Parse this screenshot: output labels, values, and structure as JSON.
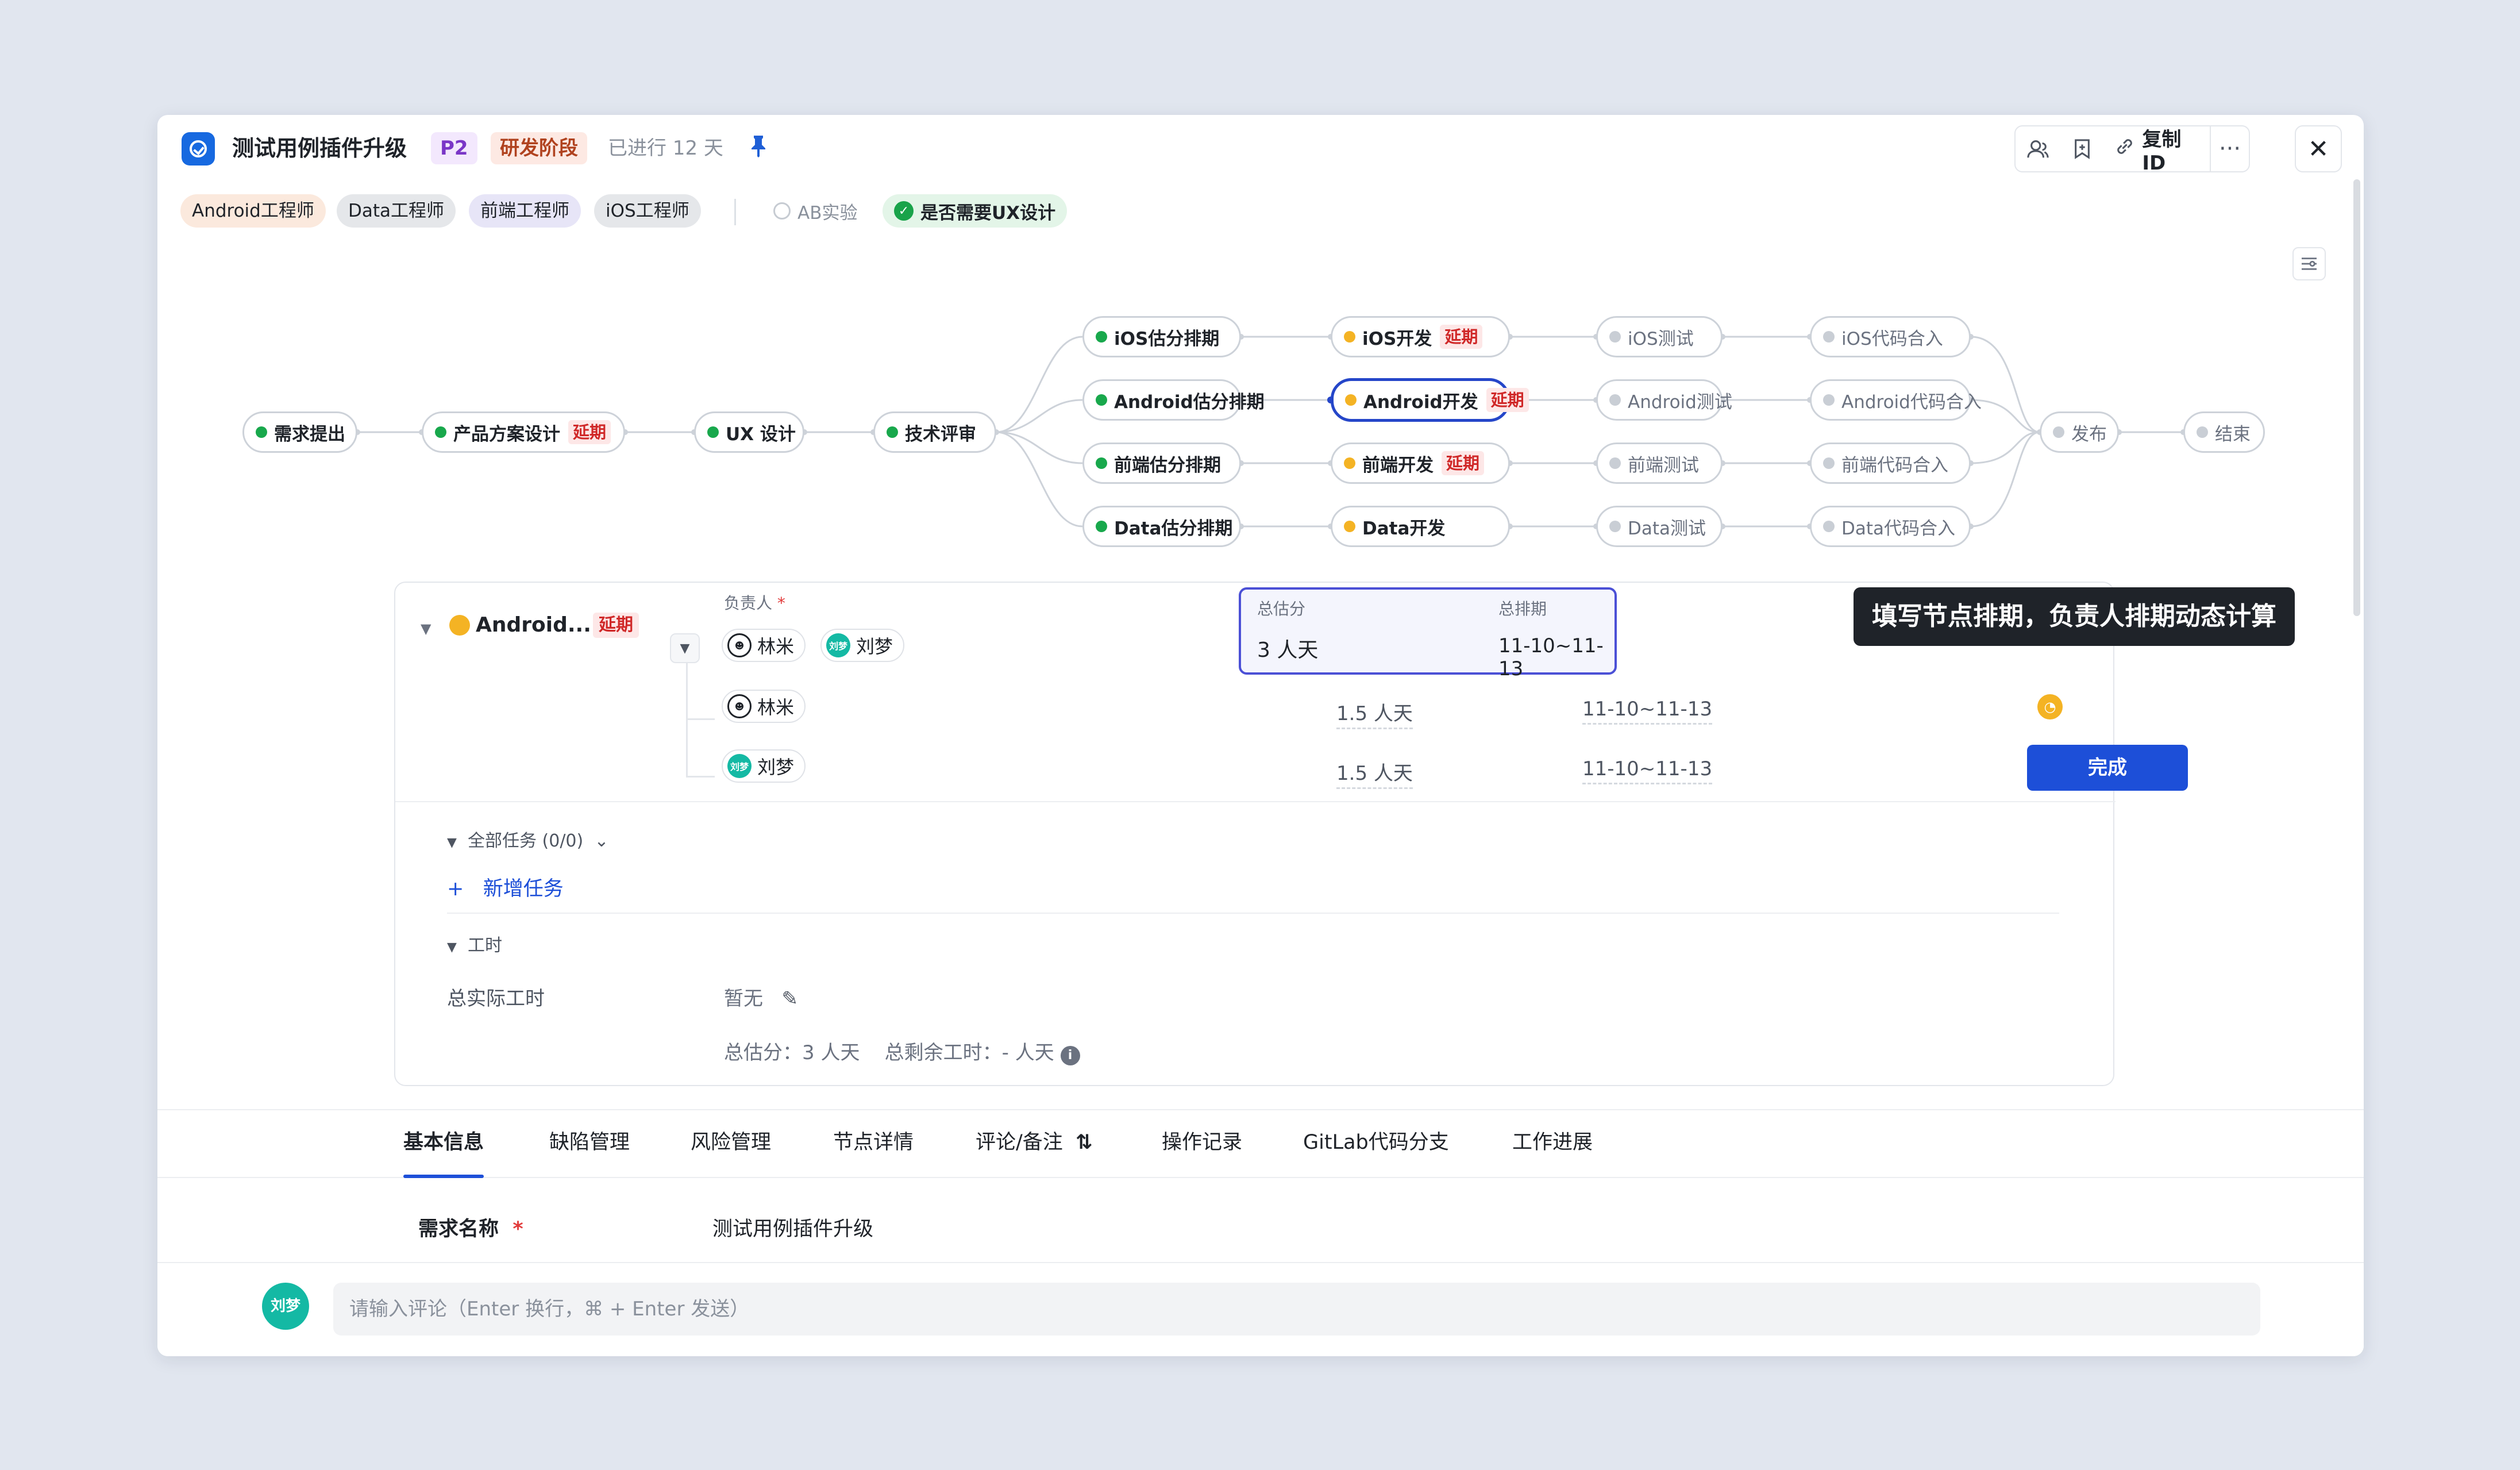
{
  "header": {
    "title": "测试用例插件升级",
    "priority": "P2",
    "stage": "研发阶段",
    "elapsed": "已进行 12 天",
    "copy_id": "复制ID",
    "more": "···",
    "close": "✕"
  },
  "roles": [
    "Android工程师",
    "Data工程师",
    "前端工程师",
    "iOS工程师"
  ],
  "toggles": {
    "ab": "AB实验",
    "ux": "是否需要UX设计"
  },
  "flow": {
    "start": "需求提出",
    "design": "产品方案设计",
    "ux": "UX 设计",
    "review": "技术评审",
    "delay": "延期",
    "estimate": [
      "iOS估分排期",
      "Android估分排期",
      "前端估分排期",
      "Data估分排期"
    ],
    "develop": [
      "iOS开发",
      "Android开发",
      "前端开发",
      "Data开发"
    ],
    "test": [
      "iOS测试",
      "Android测试",
      "前端测试",
      "Data测试"
    ],
    "merge": [
      "iOS代码合入",
      "Android代码合入",
      "前端代码合入",
      "Data代码合入"
    ],
    "release": "发布",
    "end": "结束"
  },
  "detail": {
    "node_name": "Android...",
    "delay": "延期",
    "owner_label": "负责人",
    "required": "*",
    "owners": [
      "林米",
      "刘梦"
    ],
    "avatar_liu": "刘梦",
    "total_estimate_label": "总估分",
    "total_schedule_label": "总排期",
    "total_estimate": "3 人天",
    "total_schedule": "11-10~11-13",
    "rows": [
      {
        "person": "林米",
        "estimate": "1.5 人天",
        "schedule": "11-10~11-13"
      },
      {
        "person": "刘梦",
        "estimate": "1.5 人天",
        "schedule": "11-10~11-13"
      }
    ],
    "done": "完成",
    "tooltip": "填写节点排期，负责人排期动态计算",
    "all_tasks": "全部任务 (0/0)",
    "add_task": "新增任务",
    "worktime": "工时",
    "actual_label": "总实际工时",
    "actual_value": "暂无",
    "summary": "总估分：3 人天    总剩余工时：- 人天"
  },
  "tabs": [
    "基本信息",
    "缺陷管理",
    "风险管理",
    "节点详情",
    "评论/备注",
    "操作记录",
    "GitLab代码分支",
    "工作进展"
  ],
  "basic": {
    "name_label": "需求名称",
    "required": "*",
    "name_value": "测试用例插件升级"
  },
  "comment": {
    "avatar": "刘梦",
    "placeholder": "请输入评论（Enter 换行，⌘ + Enter 发送）"
  }
}
